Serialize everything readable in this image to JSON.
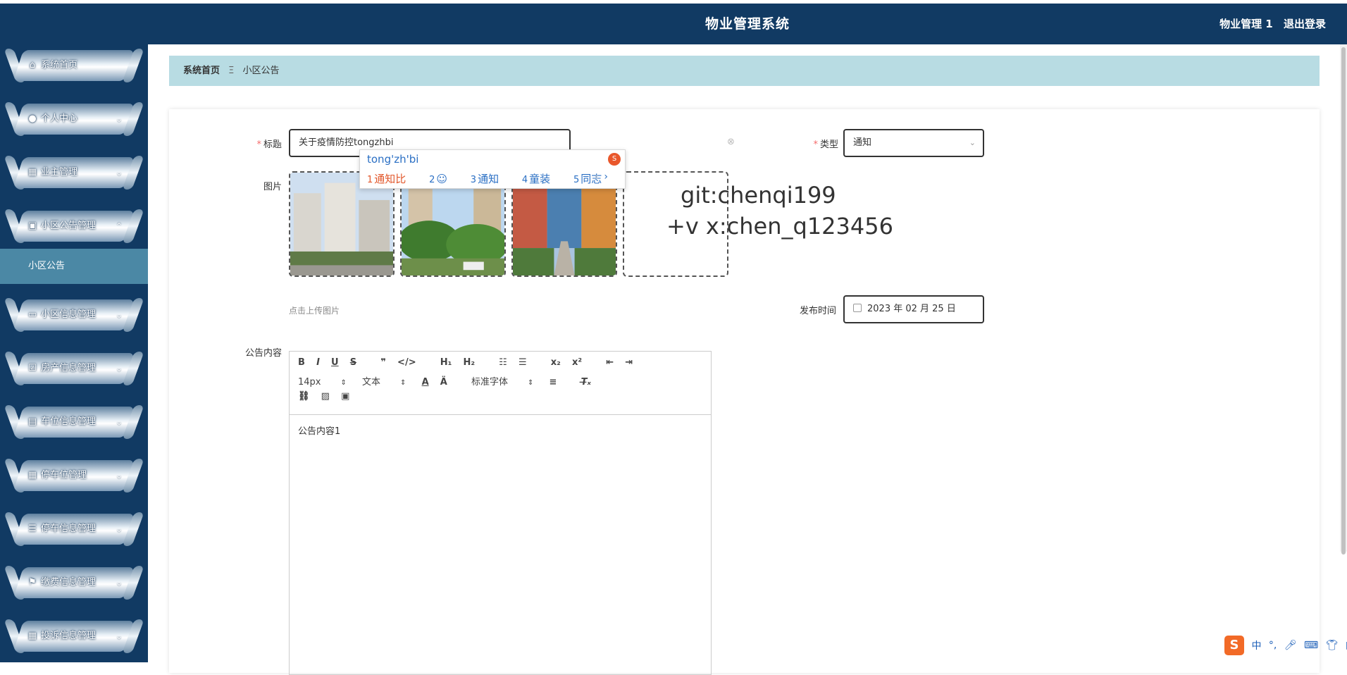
{
  "header": {
    "title": "物业管理系统",
    "user": "物业管理 1",
    "logout": "退出登录"
  },
  "sidebar": {
    "items": [
      {
        "label": "系统首页",
        "icon": "home-icon",
        "glyph": "⌂"
      },
      {
        "label": "个人中心",
        "icon": "user-icon",
        "glyph": "●"
      },
      {
        "label": "业主管理",
        "icon": "grid-icon",
        "glyph": "▦"
      },
      {
        "label": "小区公告管理",
        "icon": "briefcase-icon",
        "glyph": "▣"
      },
      {
        "label": "小区信息管理",
        "icon": "monitor-icon",
        "glyph": "▭"
      },
      {
        "label": "房产信息管理",
        "icon": "checklist-icon",
        "glyph": "☑"
      },
      {
        "label": "车位信息管理",
        "icon": "clipboard-icon",
        "glyph": "▤"
      },
      {
        "label": "停车位管理",
        "icon": "grid-icon",
        "glyph": "▦"
      },
      {
        "label": "停车信息管理",
        "icon": "list-icon",
        "glyph": "☰"
      },
      {
        "label": "缴费信息管理",
        "icon": "flag-icon",
        "glyph": "⚑"
      },
      {
        "label": "投诉信息管理",
        "icon": "grid-icon",
        "glyph": "▦"
      }
    ],
    "active_sub": "小区公告"
  },
  "breadcrumb": {
    "home": "系统首页",
    "separator": "Ξ",
    "current": "小区公告"
  },
  "form": {
    "title_label": "标题",
    "title_value": "关于疫情防控tongzhbi",
    "type_label": "类型",
    "type_value": "通知",
    "image_label": "图片",
    "upload_hint": "点击上传图片",
    "publish_label": "发布时间",
    "publish_value": "2023 年 02 月 25 日",
    "content_label": "公告内容",
    "content_value": "公告内容1"
  },
  "ime": {
    "pinyin": "tong'zh'bi",
    "candidates": [
      {
        "num": "1",
        "text": "通知比"
      },
      {
        "num": "2",
        "text": ""
      },
      {
        "num": "3",
        "text": "通知"
      },
      {
        "num": "4",
        "text": "童装"
      },
      {
        "num": "5",
        "text": "同志"
      }
    ]
  },
  "watermark": {
    "line1": "git:chenqi199",
    "line2": "+v x:chen_q123456"
  },
  "editor": {
    "size_select": "14px",
    "text_select": "文本",
    "font_select": "标准字体"
  },
  "tray": {
    "lang": "中"
  }
}
